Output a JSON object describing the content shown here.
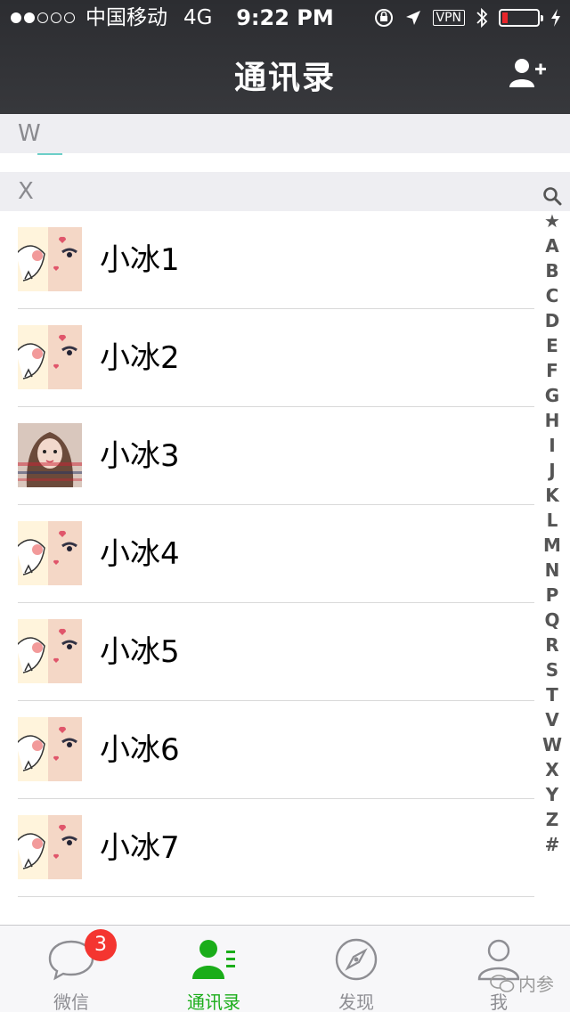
{
  "status_bar": {
    "carrier": "中国移动",
    "network": "4G",
    "time": "9:22 PM",
    "vpn": "VPN"
  },
  "nav": {
    "title": "通讯录",
    "add_icon": "add-contact-icon"
  },
  "sections": [
    {
      "letter": "W"
    },
    {
      "letter": "X"
    }
  ],
  "contacts": [
    {
      "name": "小冰1",
      "avatar": "cartoon-face"
    },
    {
      "name": "小冰2",
      "avatar": "cartoon-face"
    },
    {
      "name": "小冰3",
      "avatar": "photo-girl"
    },
    {
      "name": "小冰4",
      "avatar": "cartoon-face"
    },
    {
      "name": "小冰5",
      "avatar": "cartoon-face"
    },
    {
      "name": "小冰6",
      "avatar": "cartoon-face"
    },
    {
      "name": "小冰7",
      "avatar": "cartoon-face"
    }
  ],
  "index_bar": [
    "★",
    "A",
    "B",
    "C",
    "D",
    "E",
    "F",
    "G",
    "H",
    "I",
    "J",
    "K",
    "L",
    "M",
    "N",
    "P",
    "Q",
    "R",
    "S",
    "T",
    "V",
    "W",
    "X",
    "Y",
    "Z",
    "#"
  ],
  "tabs": [
    {
      "label": "微信",
      "icon": "chat-bubble-icon",
      "badge": "3",
      "active": false
    },
    {
      "label": "通讯录",
      "icon": "contacts-icon",
      "active": true
    },
    {
      "label": "发现",
      "icon": "compass-icon",
      "active": false
    },
    {
      "label": "我",
      "icon": "person-icon",
      "active": false
    }
  ],
  "watermark": "内参",
  "colors": {
    "accent": "#1aad19",
    "badge": "#f43530",
    "topbar": "#2c2d31",
    "section_bg": "#eeeef2"
  }
}
